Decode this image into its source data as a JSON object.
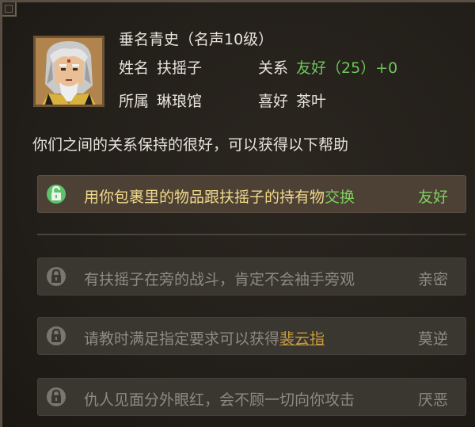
{
  "npc": {
    "title": "垂名青史（名声10级）",
    "name_label": "姓名",
    "name": "扶摇子",
    "relation_label": "关系",
    "relation": "友好（25）+0",
    "faction_label": "所属",
    "faction": "琳琅馆",
    "hobby_label": "喜好",
    "hobby": "茶叶"
  },
  "description": "你们之间的关系保持的很好，可以获得以下帮助",
  "options": [
    {
      "text_before": "用你包裹里的物品跟扶摇子的持有物",
      "highlight": "交换",
      "level": "友好",
      "state": "unlocked",
      "icon": "lock-open-icon"
    },
    {
      "text": "有扶摇子在旁的战斗，肯定不会袖手旁观",
      "level": "亲密",
      "state": "locked",
      "icon": "lock-icon"
    },
    {
      "text_before": "请教时满足指定要求可以获得",
      "highlight": "裴云指",
      "level": "莫逆",
      "state": "locked",
      "icon": "lock-icon"
    },
    {
      "text": "仇人见面分外眼红，会不顾一切向你攻击",
      "level": "厌恶",
      "state": "locked",
      "icon": "lock-icon"
    }
  ],
  "colors": {
    "accent_green": "#7fcf5e",
    "link_gold": "#c79b3e",
    "active_text": "#f0d98a",
    "locked_text": "#8f8a83"
  }
}
